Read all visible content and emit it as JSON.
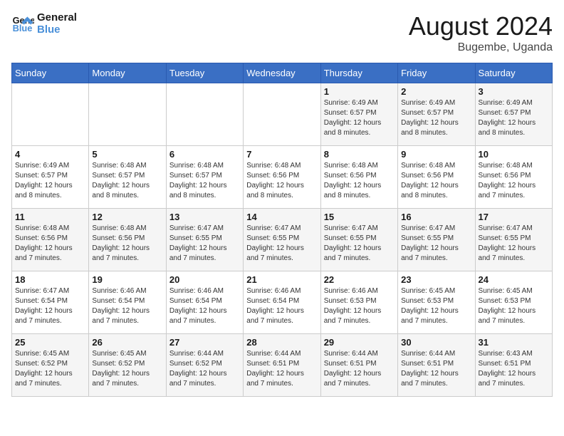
{
  "header": {
    "logo_line1": "General",
    "logo_line2": "Blue",
    "month": "August 2024",
    "location": "Bugembe, Uganda"
  },
  "days_of_week": [
    "Sunday",
    "Monday",
    "Tuesday",
    "Wednesday",
    "Thursday",
    "Friday",
    "Saturday"
  ],
  "weeks": [
    [
      {
        "day": "",
        "info": ""
      },
      {
        "day": "",
        "info": ""
      },
      {
        "day": "",
        "info": ""
      },
      {
        "day": "",
        "info": ""
      },
      {
        "day": "1",
        "info": "Sunrise: 6:49 AM\nSunset: 6:57 PM\nDaylight: 12 hours and 8 minutes."
      },
      {
        "day": "2",
        "info": "Sunrise: 6:49 AM\nSunset: 6:57 PM\nDaylight: 12 hours and 8 minutes."
      },
      {
        "day": "3",
        "info": "Sunrise: 6:49 AM\nSunset: 6:57 PM\nDaylight: 12 hours and 8 minutes."
      }
    ],
    [
      {
        "day": "4",
        "info": "Sunrise: 6:49 AM\nSunset: 6:57 PM\nDaylight: 12 hours and 8 minutes."
      },
      {
        "day": "5",
        "info": "Sunrise: 6:48 AM\nSunset: 6:57 PM\nDaylight: 12 hours and 8 minutes."
      },
      {
        "day": "6",
        "info": "Sunrise: 6:48 AM\nSunset: 6:57 PM\nDaylight: 12 hours and 8 minutes."
      },
      {
        "day": "7",
        "info": "Sunrise: 6:48 AM\nSunset: 6:56 PM\nDaylight: 12 hours and 8 minutes."
      },
      {
        "day": "8",
        "info": "Sunrise: 6:48 AM\nSunset: 6:56 PM\nDaylight: 12 hours and 8 minutes."
      },
      {
        "day": "9",
        "info": "Sunrise: 6:48 AM\nSunset: 6:56 PM\nDaylight: 12 hours and 8 minutes."
      },
      {
        "day": "10",
        "info": "Sunrise: 6:48 AM\nSunset: 6:56 PM\nDaylight: 12 hours and 7 minutes."
      }
    ],
    [
      {
        "day": "11",
        "info": "Sunrise: 6:48 AM\nSunset: 6:56 PM\nDaylight: 12 hours and 7 minutes."
      },
      {
        "day": "12",
        "info": "Sunrise: 6:48 AM\nSunset: 6:56 PM\nDaylight: 12 hours and 7 minutes."
      },
      {
        "day": "13",
        "info": "Sunrise: 6:47 AM\nSunset: 6:55 PM\nDaylight: 12 hours and 7 minutes."
      },
      {
        "day": "14",
        "info": "Sunrise: 6:47 AM\nSunset: 6:55 PM\nDaylight: 12 hours and 7 minutes."
      },
      {
        "day": "15",
        "info": "Sunrise: 6:47 AM\nSunset: 6:55 PM\nDaylight: 12 hours and 7 minutes."
      },
      {
        "day": "16",
        "info": "Sunrise: 6:47 AM\nSunset: 6:55 PM\nDaylight: 12 hours and 7 minutes."
      },
      {
        "day": "17",
        "info": "Sunrise: 6:47 AM\nSunset: 6:55 PM\nDaylight: 12 hours and 7 minutes."
      }
    ],
    [
      {
        "day": "18",
        "info": "Sunrise: 6:47 AM\nSunset: 6:54 PM\nDaylight: 12 hours and 7 minutes."
      },
      {
        "day": "19",
        "info": "Sunrise: 6:46 AM\nSunset: 6:54 PM\nDaylight: 12 hours and 7 minutes."
      },
      {
        "day": "20",
        "info": "Sunrise: 6:46 AM\nSunset: 6:54 PM\nDaylight: 12 hours and 7 minutes."
      },
      {
        "day": "21",
        "info": "Sunrise: 6:46 AM\nSunset: 6:54 PM\nDaylight: 12 hours and 7 minutes."
      },
      {
        "day": "22",
        "info": "Sunrise: 6:46 AM\nSunset: 6:53 PM\nDaylight: 12 hours and 7 minutes."
      },
      {
        "day": "23",
        "info": "Sunrise: 6:45 AM\nSunset: 6:53 PM\nDaylight: 12 hours and 7 minutes."
      },
      {
        "day": "24",
        "info": "Sunrise: 6:45 AM\nSunset: 6:53 PM\nDaylight: 12 hours and 7 minutes."
      }
    ],
    [
      {
        "day": "25",
        "info": "Sunrise: 6:45 AM\nSunset: 6:52 PM\nDaylight: 12 hours and 7 minutes."
      },
      {
        "day": "26",
        "info": "Sunrise: 6:45 AM\nSunset: 6:52 PM\nDaylight: 12 hours and 7 minutes."
      },
      {
        "day": "27",
        "info": "Sunrise: 6:44 AM\nSunset: 6:52 PM\nDaylight: 12 hours and 7 minutes."
      },
      {
        "day": "28",
        "info": "Sunrise: 6:44 AM\nSunset: 6:51 PM\nDaylight: 12 hours and 7 minutes."
      },
      {
        "day": "29",
        "info": "Sunrise: 6:44 AM\nSunset: 6:51 PM\nDaylight: 12 hours and 7 minutes."
      },
      {
        "day": "30",
        "info": "Sunrise: 6:44 AM\nSunset: 6:51 PM\nDaylight: 12 hours and 7 minutes."
      },
      {
        "day": "31",
        "info": "Sunrise: 6:43 AM\nSunset: 6:51 PM\nDaylight: 12 hours and 7 minutes."
      }
    ]
  ]
}
